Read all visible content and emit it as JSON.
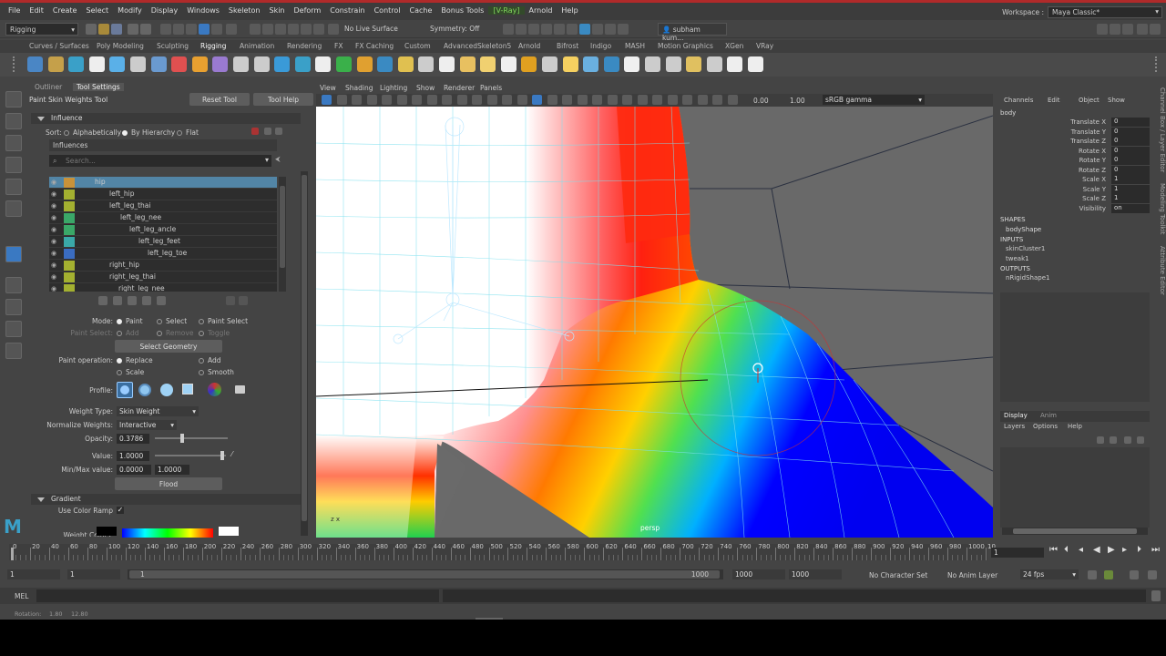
{
  "menubar": {
    "items": [
      "File",
      "Edit",
      "Create",
      "Select",
      "Modify",
      "Display",
      "Windows",
      "Skeleton",
      "Skin",
      "Deform",
      "Constrain",
      "Control",
      "Cache",
      "Bonus Tools",
      "[V-Ray]",
      "Arnold",
      "Help"
    ],
    "workspace_label": "Workspace :",
    "workspace_value": "Maya Classic*"
  },
  "statusline": {
    "mode": "Rigging",
    "live_surface": "No Live Surface",
    "symmetry": "Symmetry: Off",
    "user": "subham kum..."
  },
  "shelf_tabs": [
    "Curves / Surfaces",
    "Poly Modeling",
    "Sculpting",
    "Rigging",
    "Animation",
    "Rendering",
    "FX",
    "FX Caching",
    "Custom",
    "AdvancedSkeleton5",
    "Arnold",
    "Bifrost",
    "Indigo",
    "MASH",
    "Motion Graphics",
    "XGen",
    "VRay"
  ],
  "tool_panel": {
    "tabs": [
      "Outliner",
      "Tool Settings"
    ],
    "tool_name": "Paint Skin Weights Tool",
    "reset_tool": "Reset Tool",
    "tool_help": "Tool Help",
    "influence_section": "Influence",
    "sort_label": "Sort:",
    "sort_options": [
      "Alphabetically",
      "By Hierarchy",
      "Flat"
    ],
    "influences_label": "Influences",
    "search_placeholder": "Search...",
    "influences": [
      {
        "name": "hip",
        "color": "#c8923a",
        "selected": true
      },
      {
        "name": "left_hip",
        "color": "#a3b030",
        "selected": false
      },
      {
        "name": "left_leg_thai",
        "color": "#a3b030",
        "selected": false
      },
      {
        "name": "left_leg_nee",
        "color": "#3aa868",
        "selected": false
      },
      {
        "name": "left_leg_ancle",
        "color": "#3aa868",
        "selected": false
      },
      {
        "name": "left_leg_feet",
        "color": "#3aa8a8",
        "selected": false
      },
      {
        "name": "left_leg_toe",
        "color": "#3a6cc0",
        "selected": false
      },
      {
        "name": "right_hip",
        "color": "#a3b030",
        "selected": false
      },
      {
        "name": "right_leg_thai",
        "color": "#a3b030",
        "selected": false
      },
      {
        "name": "right_leg_nee",
        "color": "#a3b030",
        "selected": false
      }
    ],
    "mode_label": "Mode:",
    "mode_options": [
      "Paint",
      "Select",
      "Paint Select"
    ],
    "paint_select_label": "Paint Select:",
    "paint_select_options": [
      "Add",
      "Remove",
      "Toggle"
    ],
    "select_geometry": "Select Geometry",
    "paint_operation_label": "Paint operation:",
    "paint_operations": [
      "Replace",
      "Add",
      "Scale",
      "Smooth"
    ],
    "profile_label": "Profile:",
    "weight_type_label": "Weight Type:",
    "weight_type_value": "Skin Weight",
    "normalize_label": "Normalize Weights:",
    "normalize_value": "Interactive",
    "opacity_label": "Opacity:",
    "opacity_value": "0.3786",
    "value_label": "Value:",
    "value_value": "1.0000",
    "minmax_label": "Min/Max value:",
    "min_value": "0.0000",
    "max_value": "1.0000",
    "flood": "Flood",
    "gradient_section": "Gradient",
    "use_color_ramp": "Use Color Ramp",
    "weight_colors_label": "Weight Colors:"
  },
  "viewport": {
    "menu": [
      "View",
      "Shading",
      "Lighting",
      "Show",
      "Renderer",
      "Panels"
    ],
    "exposure": "0.00",
    "gamma": "1.00",
    "colorspace": "sRGB gamma",
    "camera": "persp"
  },
  "channel_box": {
    "menu": [
      "Channels",
      "Edit",
      "Object",
      "Show"
    ],
    "object": "body",
    "attrs": [
      {
        "name": "Translate X",
        "value": "0"
      },
      {
        "name": "Translate Y",
        "value": "0"
      },
      {
        "name": "Translate Z",
        "value": "0"
      },
      {
        "name": "Rotate X",
        "value": "0"
      },
      {
        "name": "Rotate Y",
        "value": "0"
      },
      {
        "name": "Rotate Z",
        "value": "0"
      },
      {
        "name": "Scale X",
        "value": "1"
      },
      {
        "name": "Scale Y",
        "value": "1"
      },
      {
        "name": "Scale Z",
        "value": "1"
      },
      {
        "name": "Visibility",
        "value": "on"
      }
    ],
    "shapes_label": "SHAPES",
    "shape": "bodyShape",
    "inputs_label": "INPUTS",
    "inputs": [
      "skinCluster1",
      "tweak1"
    ],
    "outputs_label": "OUTPUTS",
    "outputs": [
      "nRigidShape1"
    ],
    "layer_tabs": [
      "Display",
      "Anim"
    ],
    "layer_menu": [
      "Layers",
      "Options",
      "Help"
    ],
    "side_tabs": [
      "Channel Box / Layer Editor",
      "Modeling Toolkit",
      "Attribute Editor"
    ]
  },
  "timeline": {
    "ticks": [
      "0",
      "20",
      "40",
      "60",
      "80",
      "100",
      "120",
      "140",
      "160",
      "180",
      "200",
      "220",
      "240",
      "260",
      "280",
      "300",
      "320",
      "340",
      "360",
      "380",
      "400",
      "420",
      "440",
      "460",
      "480",
      "500",
      "520",
      "540",
      "560",
      "580",
      "600",
      "620",
      "640",
      "660",
      "680",
      "700",
      "720",
      "740",
      "760",
      "780",
      "800",
      "820",
      "840",
      "860",
      "880",
      "900",
      "920",
      "940",
      "960",
      "980",
      "1000",
      "10"
    ],
    "current_frame": "1"
  },
  "range": {
    "start": "1",
    "playback_start": "1",
    "slider_start": "1",
    "slider_end": "1000",
    "playback_end": "1000",
    "end": "1000",
    "character_set": "No Character Set",
    "anim_layer": "No Anim Layer",
    "fps": "24 fps"
  },
  "command": {
    "label": "MEL"
  },
  "help_line": {
    "label": "Rotation:",
    "v1": "1.80",
    "v2": "12.80"
  }
}
